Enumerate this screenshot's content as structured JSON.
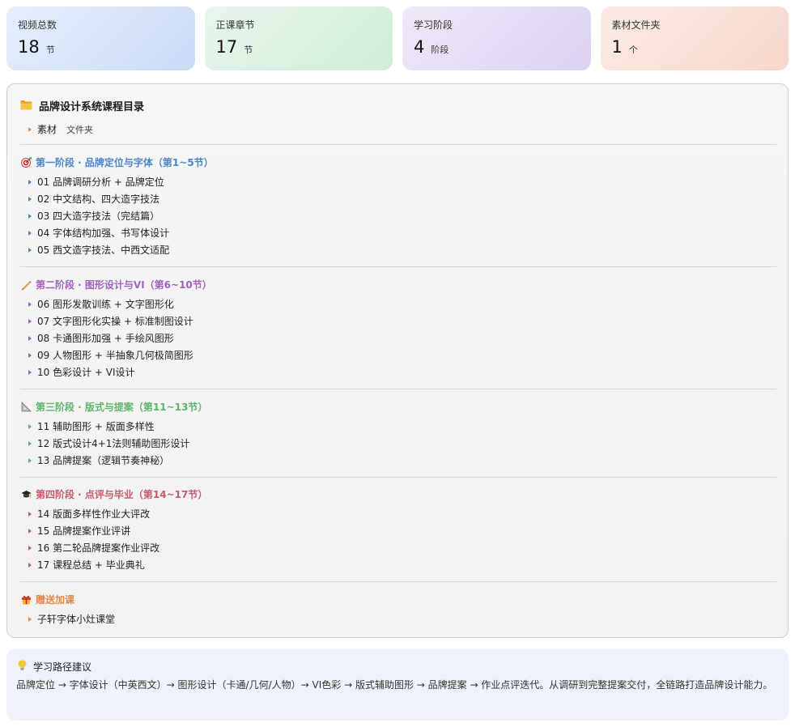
{
  "stats": [
    {
      "label": "视频总数",
      "value": "18",
      "unit": "节"
    },
    {
      "label": "正课章节",
      "value": "17",
      "unit": "节"
    },
    {
      "label": "学习阶段",
      "value": "4",
      "unit": "阶段"
    },
    {
      "label": "素材文件夹",
      "value": "1",
      "unit": "个"
    }
  ],
  "catalog": {
    "icon": "folder-icon",
    "title": "品牌设计系统课程目录",
    "material": {
      "label": "素材",
      "tag": "文件夹"
    },
    "phases": [
      {
        "icon": "target-icon",
        "color": "#4a86c8",
        "title": "第一阶段 · 品牌定位与字体（第1~5节）",
        "items": [
          "01 品牌调研分析 + 品牌定位",
          "02 中文结构、四大造字技法",
          "03 四大造字技法（完结篇）",
          "04 字体结构加强、书写体设计",
          "05 西文造字技法、中西文适配"
        ]
      },
      {
        "icon": "pencil-icon",
        "color": "#a062c0",
        "title": "第二阶段 · 图形设计与VI（第6~10节）",
        "items": [
          "06 图形发散训练 + 文字图形化",
          "07 文字图形化实操 + 标准制图设计",
          "08 卡通图形加强 + 手绘风图形",
          "09 人物图形 + 半抽象几何极简图形",
          "10 色彩设计 + VI设计"
        ]
      },
      {
        "icon": "triangle-ruler-icon",
        "color": "#5bb56d",
        "title": "第三阶段 · 版式与提案（第11~13节）",
        "items": [
          "11 辅助图形 + 版面多样性",
          "12 版式设计4+1法则辅助图形设计",
          "13 品牌提案（逻辑节奏神秘）"
        ]
      },
      {
        "icon": "graduation-cap-icon",
        "color": "#c65b6b",
        "title": "第四阶段 · 点评与毕业（第14~17节）",
        "items": [
          "14 版面多样性作业大评改",
          "15 品牌提案作业评讲",
          "16 第二轮品牌提案作业评改",
          "17 课程总结 + 毕业典礼"
        ]
      },
      {
        "icon": "gift-icon",
        "color": "#e0894a",
        "title": "赠送加课",
        "items": [
          "子轩字体小灶课堂"
        ]
      }
    ]
  },
  "advice": {
    "icon": "lightbulb-icon",
    "title": "学习路径建议",
    "body": "品牌定位 → 字体设计（中英西文）→ 图形设计（卡通/几何/人物）→ VI色彩 → 版式辅助图形 → 品牌提案 → 作业点评迭代。从调研到完整提案交付，全链路打造品牌设计能力。"
  }
}
